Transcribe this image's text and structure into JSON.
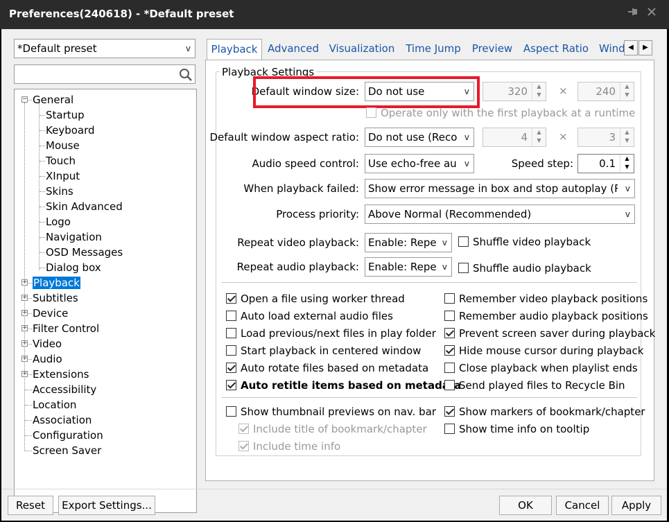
{
  "window": {
    "title": "Preferences(240618) - *Default preset"
  },
  "preset": {
    "value": "*Default preset"
  },
  "search": {
    "placeholder": ""
  },
  "tree": {
    "items": [
      {
        "label": "General",
        "expander": "−"
      },
      {
        "label": "Startup"
      },
      {
        "label": "Keyboard"
      },
      {
        "label": "Mouse"
      },
      {
        "label": "Touch"
      },
      {
        "label": "XInput"
      },
      {
        "label": "Skins"
      },
      {
        "label": "Skin Advanced"
      },
      {
        "label": "Logo"
      },
      {
        "label": "Navigation"
      },
      {
        "label": "OSD Messages"
      },
      {
        "label": "Dialog box"
      },
      {
        "label": "Playback",
        "expander": "+",
        "selected": true
      },
      {
        "label": "Subtitles",
        "expander": "+"
      },
      {
        "label": "Device",
        "expander": "+"
      },
      {
        "label": "Filter Control",
        "expander": "+"
      },
      {
        "label": "Video",
        "expander": "+"
      },
      {
        "label": "Audio",
        "expander": "+"
      },
      {
        "label": "Extensions",
        "expander": "+"
      },
      {
        "label": "Accessibility"
      },
      {
        "label": "Location"
      },
      {
        "label": "Association"
      },
      {
        "label": "Configuration"
      },
      {
        "label": "Screen Saver"
      }
    ]
  },
  "tabs": [
    "Playback",
    "Advanced",
    "Visualization",
    "Time Jump",
    "Preview",
    "Aspect Ratio",
    "Wind"
  ],
  "group_title": "Playback Settings",
  "settings": {
    "window_size_label": "Default window size:",
    "window_size_value": "Do not use",
    "window_width": "320",
    "window_height": "240",
    "times": "×",
    "operate_first": "Operate only with the first playback at a runtime",
    "aspect_label": "Default window aspect ratio:",
    "aspect_value": "Do not use (Recor",
    "aspect_x": "4",
    "aspect_y": "3",
    "audio_speed_label": "Audio speed control:",
    "audio_speed_value": "Use echo-free auc",
    "speed_step_label": "Speed step:",
    "speed_step_value": "0.1",
    "failed_label": "When playback failed:",
    "failed_value": "Show error message in box and stop autoplay (Reco",
    "priority_label": "Process priority:",
    "priority_value": "Above Normal (Recommended)",
    "repeat_video_label": "Repeat video playback:",
    "repeat_video_value": "Enable: Repea",
    "shuffle_video": "Shuffle video playback",
    "repeat_audio_label": "Repeat audio playback:",
    "repeat_audio_value": "Enable: Repea",
    "shuffle_audio": "Shuffle audio playback"
  },
  "checks_left": [
    {
      "label": "Open a file using worker thread",
      "checked": true
    },
    {
      "label": "Auto load external audio files",
      "checked": false
    },
    {
      "label": "Load previous/next files in play folder",
      "checked": false
    },
    {
      "label": "Start playback in centered window",
      "checked": false
    },
    {
      "label": "Auto rotate files based on metadata",
      "checked": true
    },
    {
      "label": "Auto retitle items based on metadata",
      "checked": true,
      "bold": true
    }
  ],
  "checks_right": [
    {
      "label": "Remember video playback positions",
      "checked": false
    },
    {
      "label": "Remember audio playback positions",
      "checked": false
    },
    {
      "label": "Prevent screen saver during playback",
      "checked": true
    },
    {
      "label": "Hide mouse cursor during playback",
      "checked": true
    },
    {
      "label": "Close playback when playlist ends",
      "checked": false
    },
    {
      "label": "Send played files to Recycle Bin",
      "checked": false
    }
  ],
  "checks_bottom": {
    "thumbnail": "Show thumbnail previews on nav. bar",
    "include_title": "Include title of bookmark/chapter",
    "include_time": "Include time info",
    "markers": "Show markers of bookmark/chapter",
    "time_tooltip": "Show time info on tooltip"
  },
  "buttons": {
    "reset": "Reset",
    "export": "Export Settings...",
    "ok": "OK",
    "cancel": "Cancel",
    "apply": "Apply"
  },
  "colors": {
    "highlight": "#e8192c",
    "selection": "#0078d7",
    "tab_text": "#1a55a5"
  }
}
